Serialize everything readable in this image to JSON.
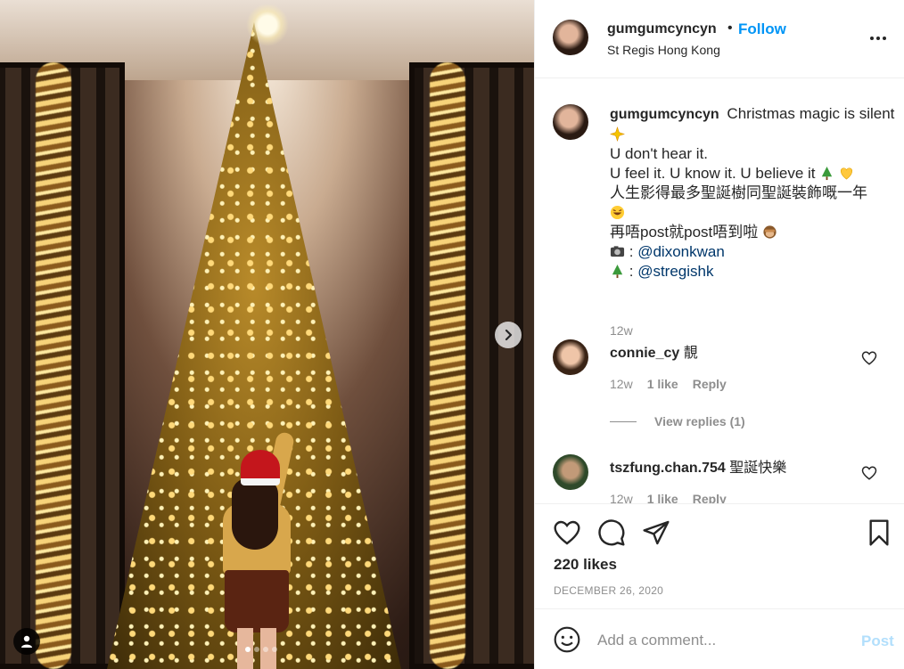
{
  "post": {
    "username": "gumgumcyncyn",
    "separator": "•",
    "follow_label": "Follow",
    "location": "St Regis Hong Kong",
    "photo_alt": "Christmas tree photo",
    "carousel_count": 4,
    "carousel_active": 0
  },
  "caption": {
    "username": "gumgumcyncyn",
    "line1": "Christmas magic is silent",
    "line2": "U don't hear it.",
    "line3": "U feel it. U know it. U believe it",
    "line4": "人生影得最多聖誕樹同聖誕裝飾嘅一年",
    "line5": "再唔post就post唔到啦",
    "photo_credit_prefix": ":",
    "photo_credit": "@dixonkwan",
    "tree_credit_prefix": ":",
    "tree_credit": "@stregishk",
    "time": "12w"
  },
  "comments": [
    {
      "username": "connie_cy",
      "text": "靚",
      "time": "12w",
      "likes": "1 like",
      "reply": "Reply"
    },
    {
      "username": "tszfung.chan.754",
      "text": "聖誕快樂",
      "time": "12w",
      "likes": "1 like",
      "reply": "Reply"
    }
  ],
  "view_replies": "View replies (1)",
  "likes": "220 likes",
  "date": "DECEMBER 26, 2020",
  "add_comment": {
    "placeholder": "Add a comment...",
    "post_label": "Post"
  },
  "colors": {
    "accent": "#0095f6",
    "post_disabled": "#b2dffc",
    "text": "#262626",
    "muted": "#8e8e8e",
    "mention": "#00376b"
  },
  "icons": [
    "next-arrow-icon",
    "user-tag-icon",
    "more-icon",
    "heart-icon",
    "comment-icon",
    "share-icon",
    "bookmark-icon",
    "smile-icon",
    "sparkle-emoji",
    "tree-emoji",
    "yellow-heart-emoji",
    "laughing-emoji",
    "monkey-emoji",
    "camera-emoji"
  ]
}
